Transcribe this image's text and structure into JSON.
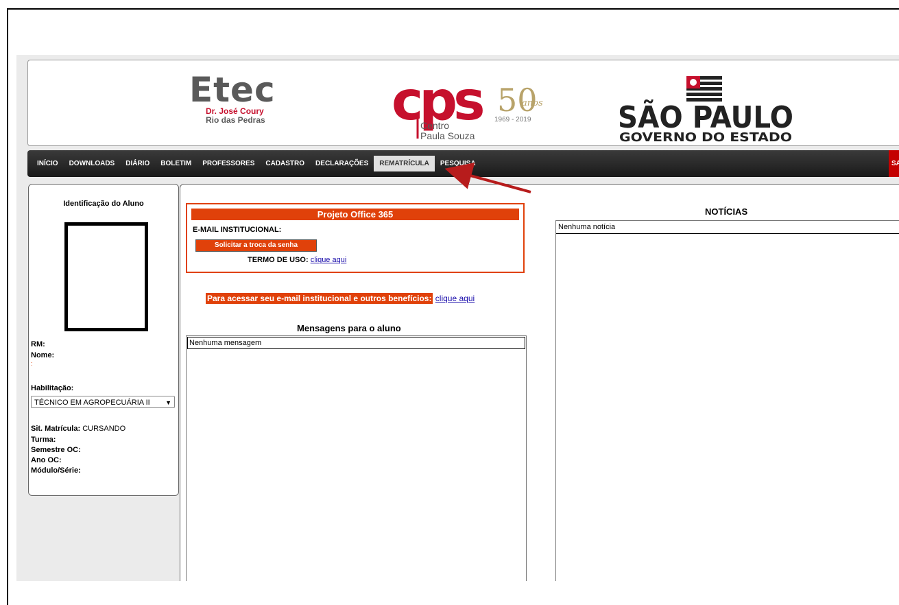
{
  "header": {
    "etec_word": "Etec",
    "etec_sub1": "Dr. José Coury",
    "etec_sub2": "Rio das Pedras",
    "cps_sub1": "Centro",
    "cps_sub2": "Paula Souza",
    "cps_years": "1969 - 2019",
    "cps_anos": "anos",
    "cps_fifty": "50",
    "cps_letters": "CPS",
    "sp_title": "SÃO PAULO",
    "sp_sub": "GOVERNO DO ESTADO"
  },
  "nav": {
    "items": [
      "INÍCIO",
      "DOWNLOADS",
      "DIÁRIO",
      "BOLETIM",
      "PROFESSORES",
      "CADASTRO",
      "DECLARAÇÕES",
      "REMATRÍCULA",
      "PESQUISA"
    ],
    "active_index": 7,
    "exit_label": "SAI"
  },
  "student": {
    "title": "Identificação do Aluno",
    "rm_label": "RM:",
    "nome_label": "Nome:",
    "nome_extra": ":",
    "habilitacao_label": "Habilitação:",
    "habilitacao_value": "TÉCNICO EM AGROPECUÁRIA II",
    "sit_label": "Sit. Matrícula:",
    "sit_value": "CURSANDO",
    "turma_label": "Turma:",
    "semestre_label": "Semestre OC:",
    "ano_label": "Ano OC:",
    "modulo_label": "Módulo/Série:"
  },
  "office365": {
    "title": "Projeto Office 365",
    "email_label": "E-MAIL INSTITUCIONAL:",
    "button_label": "Solicitar a troca da senha",
    "termo_label": "TERMO DE USO:",
    "termo_link": "clique aqui"
  },
  "access": {
    "highlight": "Para acessar seu e-mail institucional e outros benefícios:",
    "link": "clique aqui"
  },
  "messages": {
    "title": "Mensagens para o aluno",
    "empty": "Nenhuma mensagem"
  },
  "news": {
    "title": "NOTÍCIAS",
    "empty": "Nenhuma notícia"
  },
  "colors": {
    "accent_orange": "#e0410a",
    "nav_dark": "#222222",
    "exit_red": "#c40000",
    "arrow_red": "#b71c1c"
  }
}
